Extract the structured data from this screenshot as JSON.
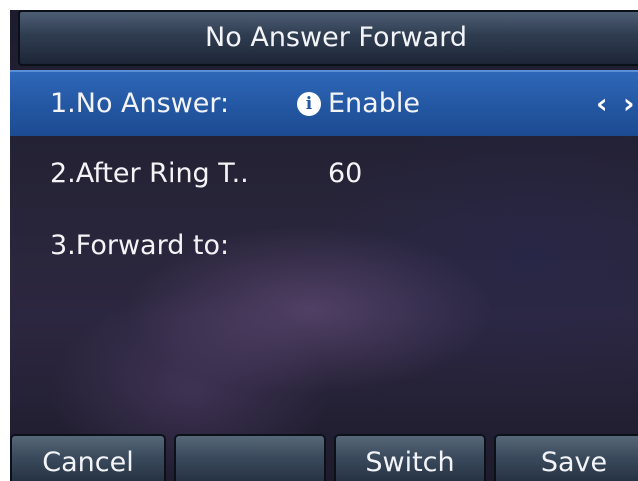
{
  "header": {
    "title": "No Answer Forward"
  },
  "rows": [
    {
      "label": "1.No Answer:",
      "value": "Enable",
      "icon": "info-icon",
      "selected": true
    },
    {
      "label": "2.After Ring T..",
      "value": "60",
      "selected": false
    },
    {
      "label": "3.Forward to:",
      "value": "",
      "selected": false
    }
  ],
  "navigation": {
    "left_arrow": "‹",
    "right_arrow": "›"
  },
  "softkeys": [
    {
      "label": "Cancel"
    },
    {
      "label": ""
    },
    {
      "label": "Switch"
    },
    {
      "label": "Save"
    }
  ],
  "colors": {
    "selection": "#2458a4",
    "background": "#272438",
    "title_bar": "#2f3c50"
  }
}
